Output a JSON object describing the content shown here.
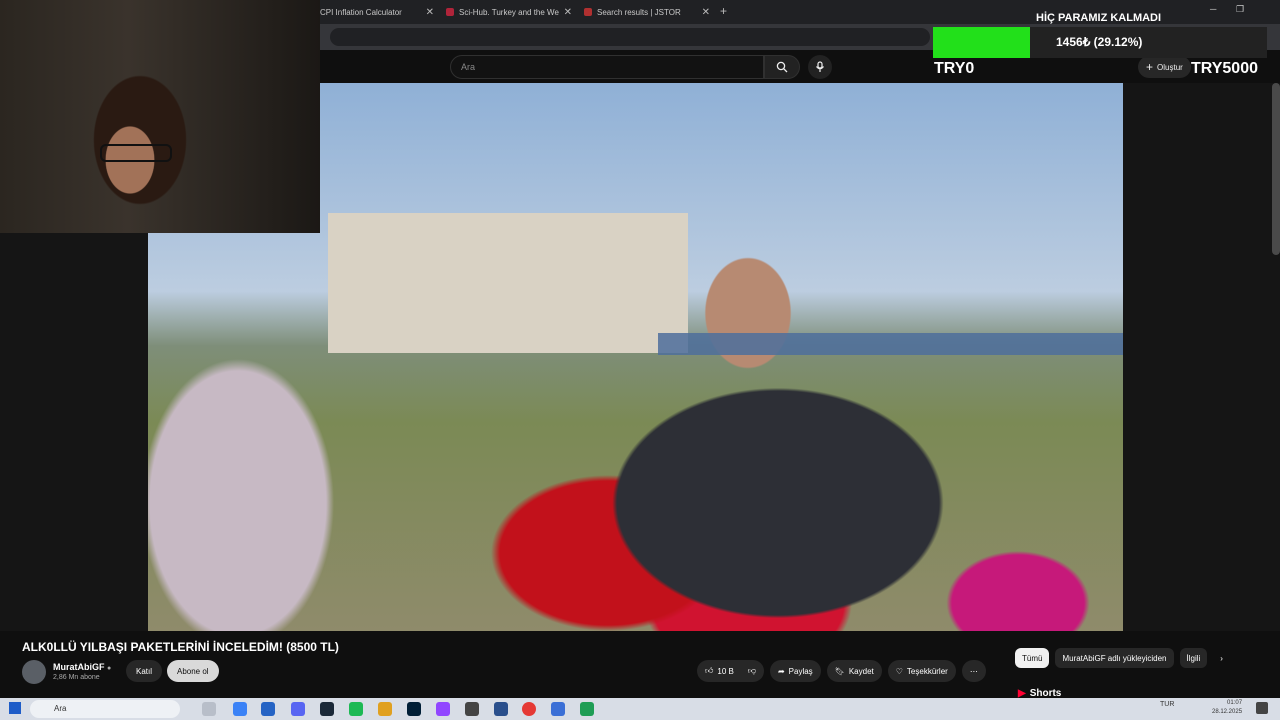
{
  "browser": {
    "tabs": [
      {
        "label": "CPI Inflation Calculator"
      },
      {
        "label": "Sci-Hub. Turkey and the West: ..."
      },
      {
        "label": "Search results | JSTOR"
      }
    ]
  },
  "youtube": {
    "search_placeholder": "Ara",
    "create_label": "Oluştur"
  },
  "overlay": {
    "title": "HİÇ PARAMIZ KALMADI",
    "progress_text": "1456₺ (29.12%)",
    "progress_fraction": 0.2912,
    "min_label": "TRY0",
    "max_label": "TRY5000",
    "fill_color": "#22e01a"
  },
  "video": {
    "title": "ALK0LLÜ YILBAŞI PAKETLERİNİ İNCELEDİM! (8500 TL)",
    "channel": "MuratAbiGF",
    "subscribers": "2,86 Mn abone",
    "join_label": "Katıl",
    "subscribe_label": "Abone ol",
    "likes": "10 B",
    "share_label": "Paylaş",
    "save_label": "Kaydet",
    "thanks_label": "Teşekkürler"
  },
  "chips": [
    {
      "label": "Tümü"
    },
    {
      "label": "MuratAbiGF adlı yükleyiciden"
    },
    {
      "label": "İlgili"
    }
  ],
  "shorts_label": "Shorts",
  "taskbar": {
    "search_placeholder": "Ara",
    "language": "TUR",
    "time": "01:07",
    "date": "28.12.2025"
  }
}
